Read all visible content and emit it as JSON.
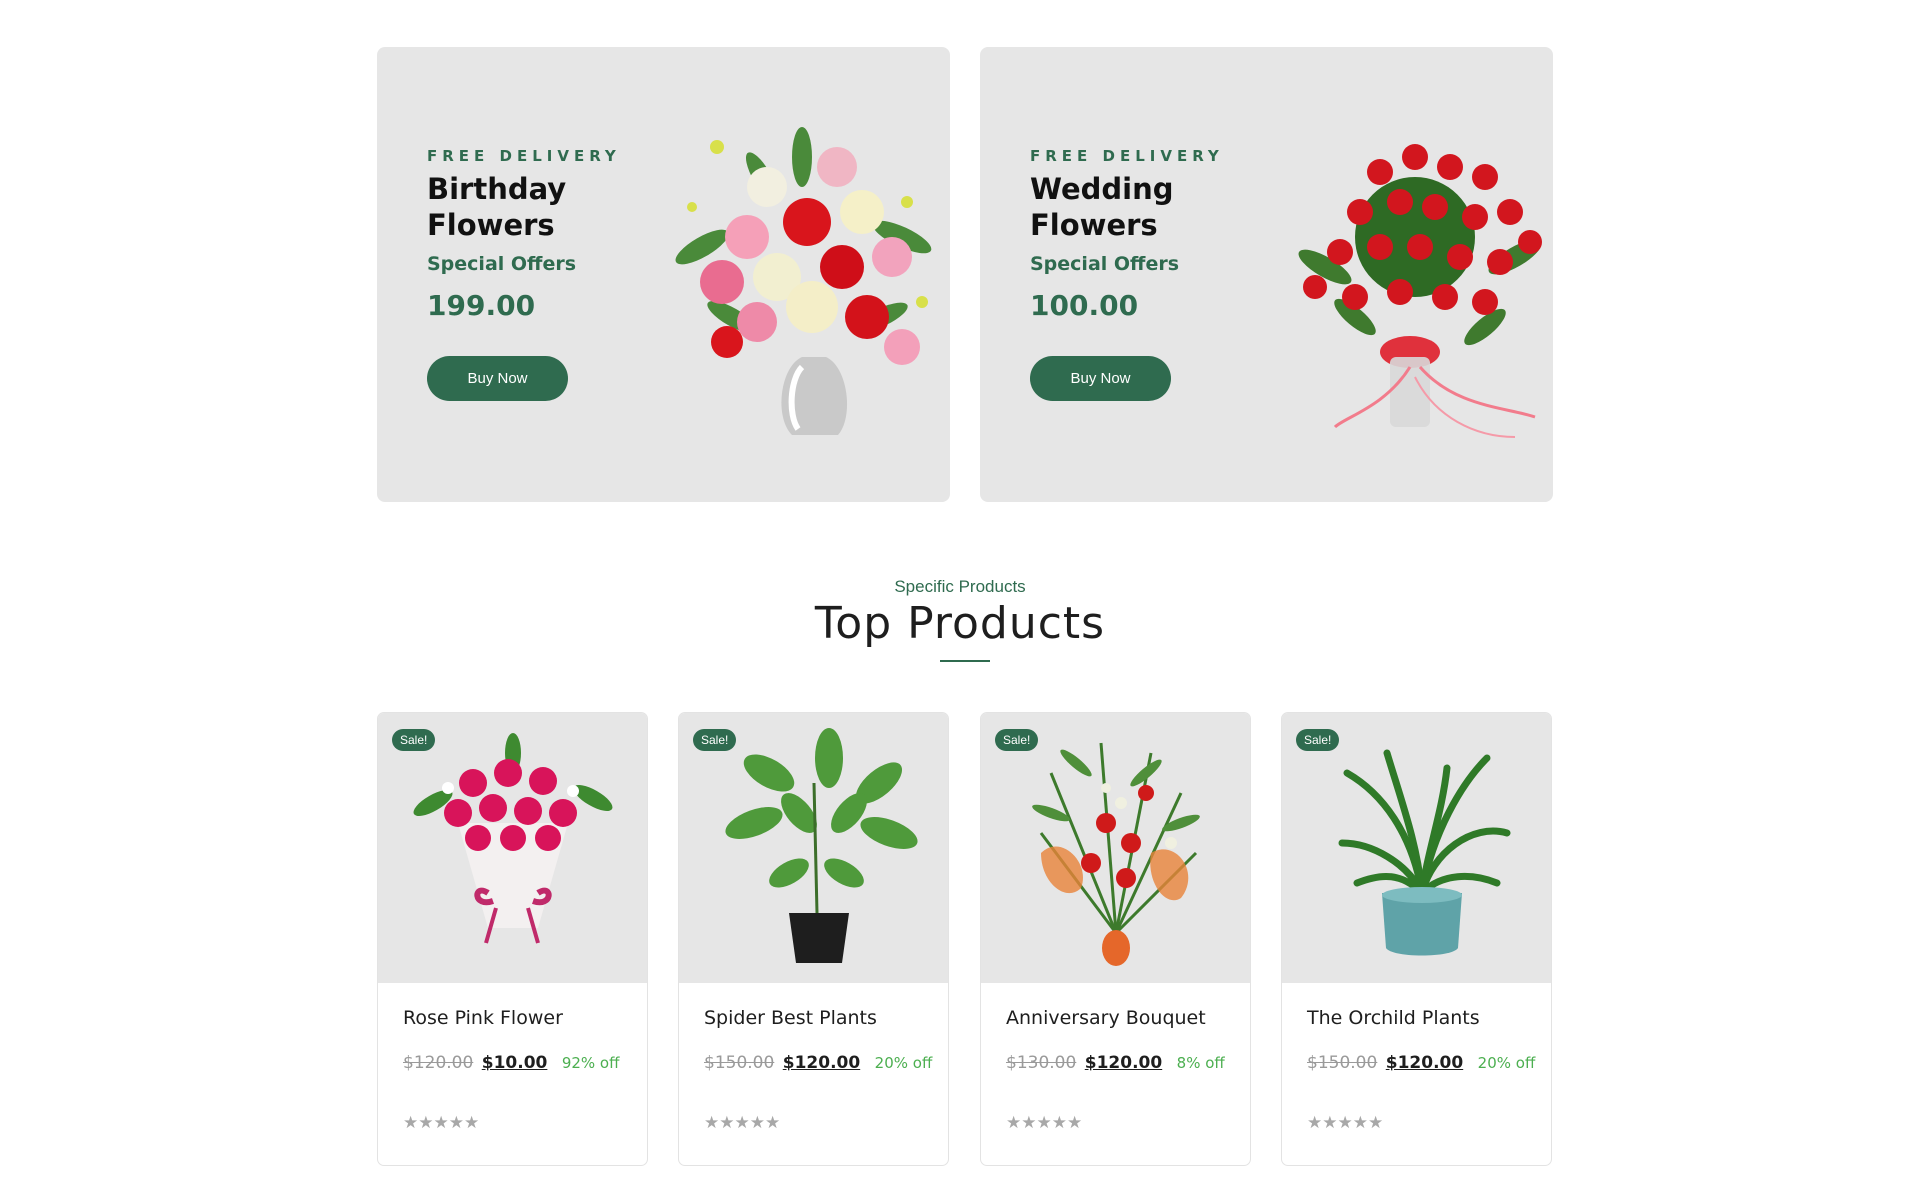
{
  "banners": [
    {
      "tag": "FREE DELIVERY",
      "title": "Birthday Flowers",
      "offer": "Special Offers",
      "price": "199.00",
      "button": "Buy Now",
      "image": "flower-vase-bouquet"
    },
    {
      "tag": "FREE DELIVERY",
      "title": "Wedding Flowers",
      "offer": "Special Offers",
      "price": "100.00",
      "button": "Buy Now",
      "image": "red-roses-vase"
    }
  ],
  "section": {
    "subtitle": "Specific Products",
    "title": "Top Products"
  },
  "products": [
    {
      "badge": "Sale!",
      "name": "Rose Pink Flower",
      "old_price": "$120.00",
      "price": "$10.00",
      "discount": "92% off",
      "stars": "★★★★★",
      "rating": 0,
      "image": "pink-rose-bouquet"
    },
    {
      "badge": "Sale!",
      "name": "Spider Best Plants",
      "old_price": "$150.00",
      "price": "$120.00",
      "discount": "20% off",
      "stars": "★★★★★",
      "rating": 0,
      "image": "potted-plant"
    },
    {
      "badge": "Sale!",
      "name": "Anniversary Bouquet",
      "old_price": "$130.00",
      "price": "$120.00",
      "discount": "8% off",
      "stars": "★★★★★",
      "rating": 0,
      "image": "anniversary-bouquet"
    },
    {
      "badge": "Sale!",
      "name": "The Orchild Plants",
      "old_price": "$150.00",
      "price": "$120.00",
      "discount": "20% off",
      "stars": "★★★★★",
      "rating": 0,
      "image": "blue-pot-plant"
    }
  ],
  "colors": {
    "brand_green": "#2f6b4f",
    "discount_green": "#4caf50",
    "card_bg": "#e6e6e6"
  }
}
